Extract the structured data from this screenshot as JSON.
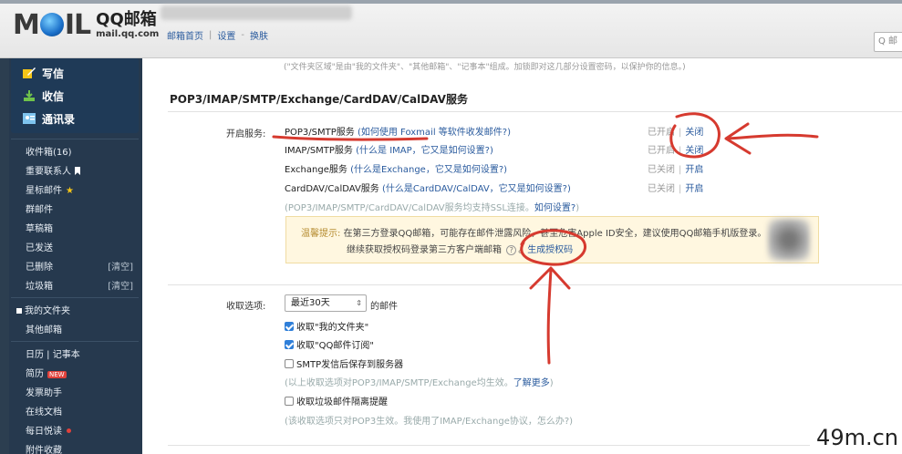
{
  "header": {
    "logo_word": "MAIL",
    "logo_cn": "QQ邮箱",
    "logo_url": "mail.qq.com",
    "nav": [
      "邮箱首页",
      "设置",
      "换肤"
    ],
    "search_placeholder": "Q 邮"
  },
  "sidebar": {
    "quick": [
      {
        "label": "写信",
        "icon": "compose-icon"
      },
      {
        "label": "收信",
        "icon": "inbox-download-icon"
      },
      {
        "label": "通讯录",
        "icon": "contacts-icon"
      }
    ],
    "folders": [
      {
        "label": "收件箱(16)",
        "extra": ""
      },
      {
        "label": "重要联系人",
        "extra": "",
        "icon": "bookmark-icon"
      },
      {
        "label": "星标邮件",
        "extra": "",
        "icon": "star-icon"
      },
      {
        "label": "群邮件",
        "extra": ""
      },
      {
        "label": "草稿箱",
        "extra": ""
      },
      {
        "label": "已发送",
        "extra": ""
      },
      {
        "label": "已删除",
        "extra": "[清空]"
      },
      {
        "label": "垃圾箱",
        "extra": "[清空]"
      }
    ],
    "my_folders": "我的文件夹",
    "other_mailbox": "其他邮箱",
    "tools": [
      {
        "label": "日历 | 记事本"
      },
      {
        "label": "简历",
        "badge": "NEW"
      },
      {
        "label": "发票助手"
      },
      {
        "label": "在线文档"
      },
      {
        "label": "每日悦读",
        "dot": true
      },
      {
        "label": "附件收藏"
      }
    ]
  },
  "main": {
    "top_note": "(\"文件夹区域\"是由\"我的文件夹\"、\"其他邮箱\"、\"记事本\"组成。加锁即对这几部分设置密码，以保护你的信息。)",
    "section_title": "POP3/IMAP/SMTP/Exchange/CardDAV/CalDAV服务",
    "open_service_label": "开启服务:",
    "services": [
      {
        "name": "POP3/SMTP服务",
        "help": "(如何使用 Foxmail 等软件收发邮件?)",
        "status": "已开启",
        "action": "关闭"
      },
      {
        "name": "IMAP/SMTP服务",
        "help": "(什么是 IMAP，它又是如何设置?)",
        "status": "已开启",
        "action": "关闭"
      },
      {
        "name": "Exchange服务",
        "help": "(什么是Exchange，它又是如何设置?)",
        "status": "已关闭",
        "action": "开启"
      },
      {
        "name": "CardDAV/CalDAV服务",
        "help": "(什么是CardDAV/CalDAV，它又是如何设置?)",
        "status": "已关闭",
        "action": "开启"
      }
    ],
    "ssl_note": "(POP3/IMAP/SMTP/CardDAV/CalDAV服务均支持SSL连接。",
    "ssl_link": "如何设置?",
    "ssl_close": ")",
    "tip": {
      "prefix": "温馨提示:",
      "line1": "在第三方登录QQ邮箱，可能存在邮件泄露风险，甚至危害Apple ID安全，建议使用QQ邮箱手机版登录。",
      "line2_pre": "继续获取授权码登录第三方客户端邮箱",
      "qmark": "?",
      "link": "生成授权码"
    },
    "receive_label": "收取选项:",
    "receive_select": "最近30天",
    "receive_suffix": "的邮件",
    "options": [
      {
        "label": "收取\"我的文件夹\"",
        "checked": true
      },
      {
        "label": "收取\"QQ邮件订阅\"",
        "checked": true
      },
      {
        "label": "SMTP发信后保存到服务器",
        "checked": false
      }
    ],
    "opt_note": "(以上收取选项对POP3/IMAP/SMTP/Exchange均生效。",
    "opt_note_link": "了解更多",
    "opt_note_close": ")",
    "spam_option": "收取垃圾邮件隔离提醒",
    "spam_note": "(该收取选项只对POP3生效。我使用了IMAP/Exchange协议，怎么办?)"
  },
  "watermark": "49m.cn",
  "colors": {
    "accent_link": "#2a5b9e",
    "sidebar": "#26394e",
    "annotation_red": "#d63a2f",
    "tip_bg": "#fff7e0"
  }
}
